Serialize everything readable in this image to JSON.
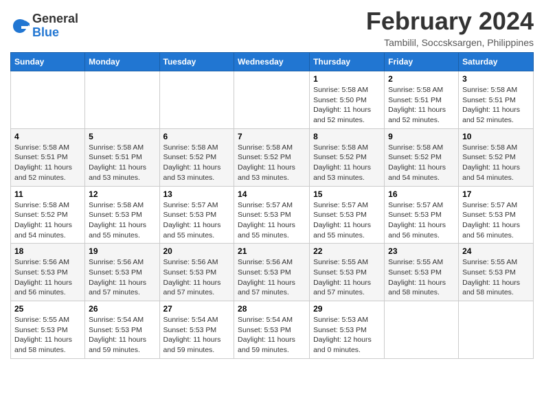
{
  "header": {
    "logo_general": "General",
    "logo_blue": "Blue",
    "month_title": "February 2024",
    "location": "Tambilil, Soccsksargen, Philippines"
  },
  "weekdays": [
    "Sunday",
    "Monday",
    "Tuesday",
    "Wednesday",
    "Thursday",
    "Friday",
    "Saturday"
  ],
  "weeks": [
    [
      {
        "day": "",
        "info": ""
      },
      {
        "day": "",
        "info": ""
      },
      {
        "day": "",
        "info": ""
      },
      {
        "day": "",
        "info": ""
      },
      {
        "day": "1",
        "info": "Sunrise: 5:58 AM\nSunset: 5:50 PM\nDaylight: 11 hours\nand 52 minutes."
      },
      {
        "day": "2",
        "info": "Sunrise: 5:58 AM\nSunset: 5:51 PM\nDaylight: 11 hours\nand 52 minutes."
      },
      {
        "day": "3",
        "info": "Sunrise: 5:58 AM\nSunset: 5:51 PM\nDaylight: 11 hours\nand 52 minutes."
      }
    ],
    [
      {
        "day": "4",
        "info": "Sunrise: 5:58 AM\nSunset: 5:51 PM\nDaylight: 11 hours\nand 52 minutes."
      },
      {
        "day": "5",
        "info": "Sunrise: 5:58 AM\nSunset: 5:51 PM\nDaylight: 11 hours\nand 53 minutes."
      },
      {
        "day": "6",
        "info": "Sunrise: 5:58 AM\nSunset: 5:52 PM\nDaylight: 11 hours\nand 53 minutes."
      },
      {
        "day": "7",
        "info": "Sunrise: 5:58 AM\nSunset: 5:52 PM\nDaylight: 11 hours\nand 53 minutes."
      },
      {
        "day": "8",
        "info": "Sunrise: 5:58 AM\nSunset: 5:52 PM\nDaylight: 11 hours\nand 53 minutes."
      },
      {
        "day": "9",
        "info": "Sunrise: 5:58 AM\nSunset: 5:52 PM\nDaylight: 11 hours\nand 54 minutes."
      },
      {
        "day": "10",
        "info": "Sunrise: 5:58 AM\nSunset: 5:52 PM\nDaylight: 11 hours\nand 54 minutes."
      }
    ],
    [
      {
        "day": "11",
        "info": "Sunrise: 5:58 AM\nSunset: 5:52 PM\nDaylight: 11 hours\nand 54 minutes."
      },
      {
        "day": "12",
        "info": "Sunrise: 5:58 AM\nSunset: 5:53 PM\nDaylight: 11 hours\nand 55 minutes."
      },
      {
        "day": "13",
        "info": "Sunrise: 5:57 AM\nSunset: 5:53 PM\nDaylight: 11 hours\nand 55 minutes."
      },
      {
        "day": "14",
        "info": "Sunrise: 5:57 AM\nSunset: 5:53 PM\nDaylight: 11 hours\nand 55 minutes."
      },
      {
        "day": "15",
        "info": "Sunrise: 5:57 AM\nSunset: 5:53 PM\nDaylight: 11 hours\nand 55 minutes."
      },
      {
        "day": "16",
        "info": "Sunrise: 5:57 AM\nSunset: 5:53 PM\nDaylight: 11 hours\nand 56 minutes."
      },
      {
        "day": "17",
        "info": "Sunrise: 5:57 AM\nSunset: 5:53 PM\nDaylight: 11 hours\nand 56 minutes."
      }
    ],
    [
      {
        "day": "18",
        "info": "Sunrise: 5:56 AM\nSunset: 5:53 PM\nDaylight: 11 hours\nand 56 minutes."
      },
      {
        "day": "19",
        "info": "Sunrise: 5:56 AM\nSunset: 5:53 PM\nDaylight: 11 hours\nand 57 minutes."
      },
      {
        "day": "20",
        "info": "Sunrise: 5:56 AM\nSunset: 5:53 PM\nDaylight: 11 hours\nand 57 minutes."
      },
      {
        "day": "21",
        "info": "Sunrise: 5:56 AM\nSunset: 5:53 PM\nDaylight: 11 hours\nand 57 minutes."
      },
      {
        "day": "22",
        "info": "Sunrise: 5:55 AM\nSunset: 5:53 PM\nDaylight: 11 hours\nand 57 minutes."
      },
      {
        "day": "23",
        "info": "Sunrise: 5:55 AM\nSunset: 5:53 PM\nDaylight: 11 hours\nand 58 minutes."
      },
      {
        "day": "24",
        "info": "Sunrise: 5:55 AM\nSunset: 5:53 PM\nDaylight: 11 hours\nand 58 minutes."
      }
    ],
    [
      {
        "day": "25",
        "info": "Sunrise: 5:55 AM\nSunset: 5:53 PM\nDaylight: 11 hours\nand 58 minutes."
      },
      {
        "day": "26",
        "info": "Sunrise: 5:54 AM\nSunset: 5:53 PM\nDaylight: 11 hours\nand 59 minutes."
      },
      {
        "day": "27",
        "info": "Sunrise: 5:54 AM\nSunset: 5:53 PM\nDaylight: 11 hours\nand 59 minutes."
      },
      {
        "day": "28",
        "info": "Sunrise: 5:54 AM\nSunset: 5:53 PM\nDaylight: 11 hours\nand 59 minutes."
      },
      {
        "day": "29",
        "info": "Sunrise: 5:53 AM\nSunset: 5:53 PM\nDaylight: 12 hours\nand 0 minutes."
      },
      {
        "day": "",
        "info": ""
      },
      {
        "day": "",
        "info": ""
      }
    ]
  ]
}
